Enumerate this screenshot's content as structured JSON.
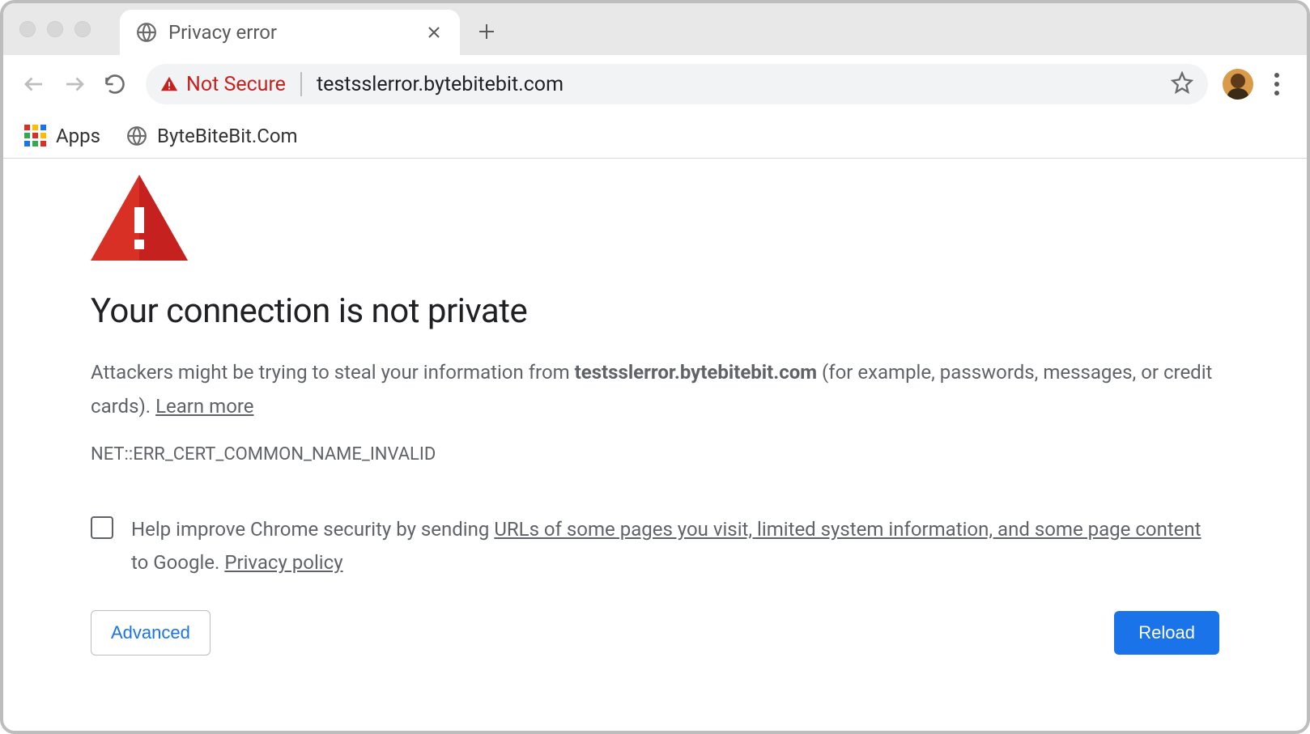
{
  "tab": {
    "title": "Privacy error"
  },
  "omnibox": {
    "security_label": "Not Secure",
    "url": "testsslerror.bytebitebit.com"
  },
  "bookmarks": {
    "apps_label": "Apps",
    "items": [
      {
        "label": "ByteBiteBit.Com"
      }
    ]
  },
  "interstitial": {
    "heading": "Your connection is not private",
    "body_prefix": "Attackers might be trying to steal your information from ",
    "body_domain": "testsslerror.bytebitebit.com",
    "body_suffix": " (for example, passwords, messages, or credit cards). ",
    "learn_more": "Learn more",
    "error_code": "NET::ERR_CERT_COMMON_NAME_INVALID",
    "opt_in_prefix": "Help improve Chrome security by sending ",
    "opt_in_link1": "URLs of some pages you visit, limited system information, and some page content",
    "opt_in_mid": " to Google. ",
    "opt_in_privacy": "Privacy policy",
    "advanced_label": "Advanced",
    "reload_label": "Reload"
  }
}
